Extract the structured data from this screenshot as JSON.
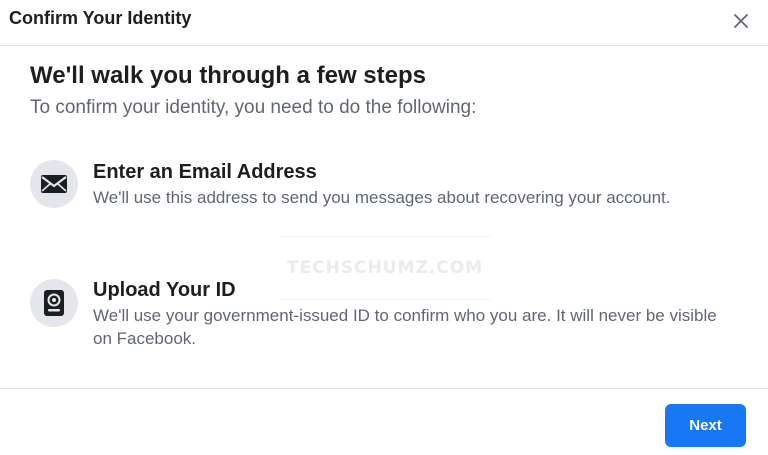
{
  "dialog": {
    "title": "Confirm Your Identity",
    "heading": "We'll walk you through a few steps",
    "subheading": "To confirm your identity, you need to do the following:",
    "steps": [
      {
        "icon": "envelope-icon",
        "title": "Enter an Email Address",
        "description": "We'll use this address to send you messages about recovering your account."
      },
      {
        "icon": "id-card-icon",
        "title": "Upload Your ID",
        "description": "We'll use your government-issued ID to confirm who you are. It will never be visible on Facebook."
      }
    ],
    "next_label": "Next"
  },
  "watermark": "TECHSCHUMZ.COM",
  "colors": {
    "primary_button": "#1877f2",
    "icon_background": "#e4e6eb",
    "secondary_text": "#606770",
    "divider": "#dadde1"
  }
}
